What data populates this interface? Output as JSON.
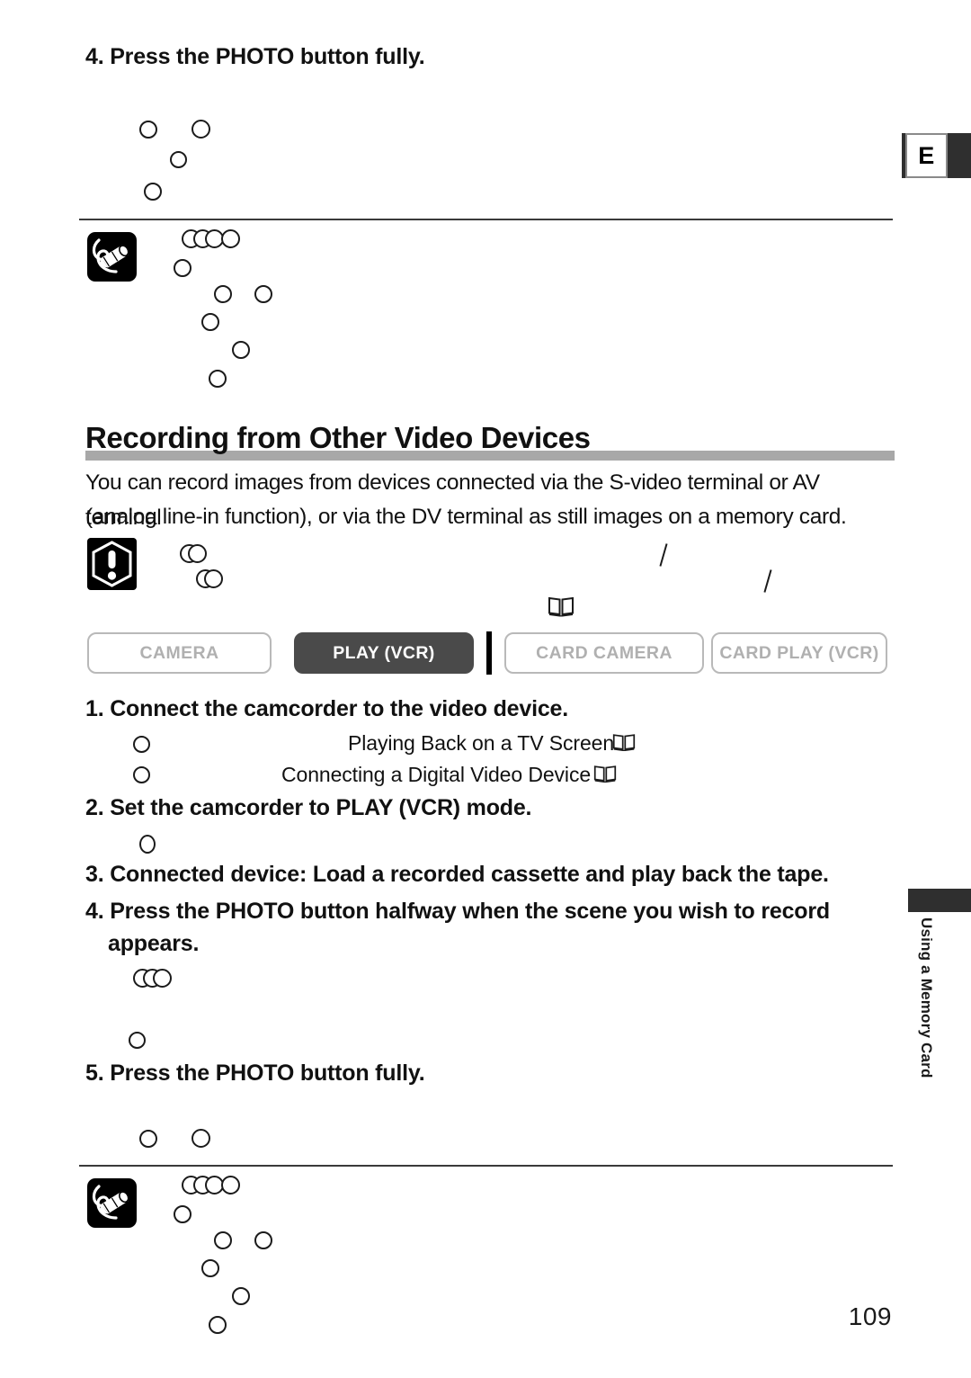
{
  "page": {
    "number": "109",
    "language_tab": "E",
    "section_tab_label": "Using a Memory Card"
  },
  "top_step": {
    "heading": "4. Press the PHOTO button fully."
  },
  "section": {
    "title": "Recording from Other Video Devices",
    "intro_line1": "You can record images from devices connected via the S-video terminal or AV terminal",
    "intro_line2": "(analog line-in function), or via the DV terminal as still images on a memory card."
  },
  "mode_buttons": [
    {
      "label": "CAMERA",
      "active": false
    },
    {
      "label": "PLAY (VCR)",
      "active": true
    },
    {
      "label": "CARD CAMERA",
      "active": false
    },
    {
      "label": "CARD PLAY (VCR)",
      "active": false
    }
  ],
  "steps": [
    {
      "number": "1",
      "heading": "1. Connect the camcorder to the video device."
    },
    {
      "number": "2",
      "heading": "2. Set the camcorder to PLAY (VCR) mode."
    },
    {
      "number": "3",
      "heading": "3. Connected device: Load a recorded cassette and play back the tape."
    },
    {
      "number": "4",
      "heading": "4. Press the PHOTO button halfway when the scene you wish to record"
    },
    {
      "number": "4b",
      "heading": "appears."
    },
    {
      "number": "5",
      "heading": "5. Press the PHOTO button fully."
    }
  ],
  "cross_references": [
    {
      "text": "Playing Back on a TV Screen"
    },
    {
      "text": "Connecting a Digital Video Device"
    }
  ],
  "icons": {
    "note": "pencil-note-icon",
    "warning": "warning-exclamation-icon",
    "book": "book-reference-icon"
  },
  "colors": {
    "title_bar": "#a8a8a8",
    "active_button": "#4a4a4a",
    "inactive_button_border": "#b9b9b9",
    "inactive_button_text": "#b0b0b0",
    "tab_dark": "#2f2f2f"
  }
}
